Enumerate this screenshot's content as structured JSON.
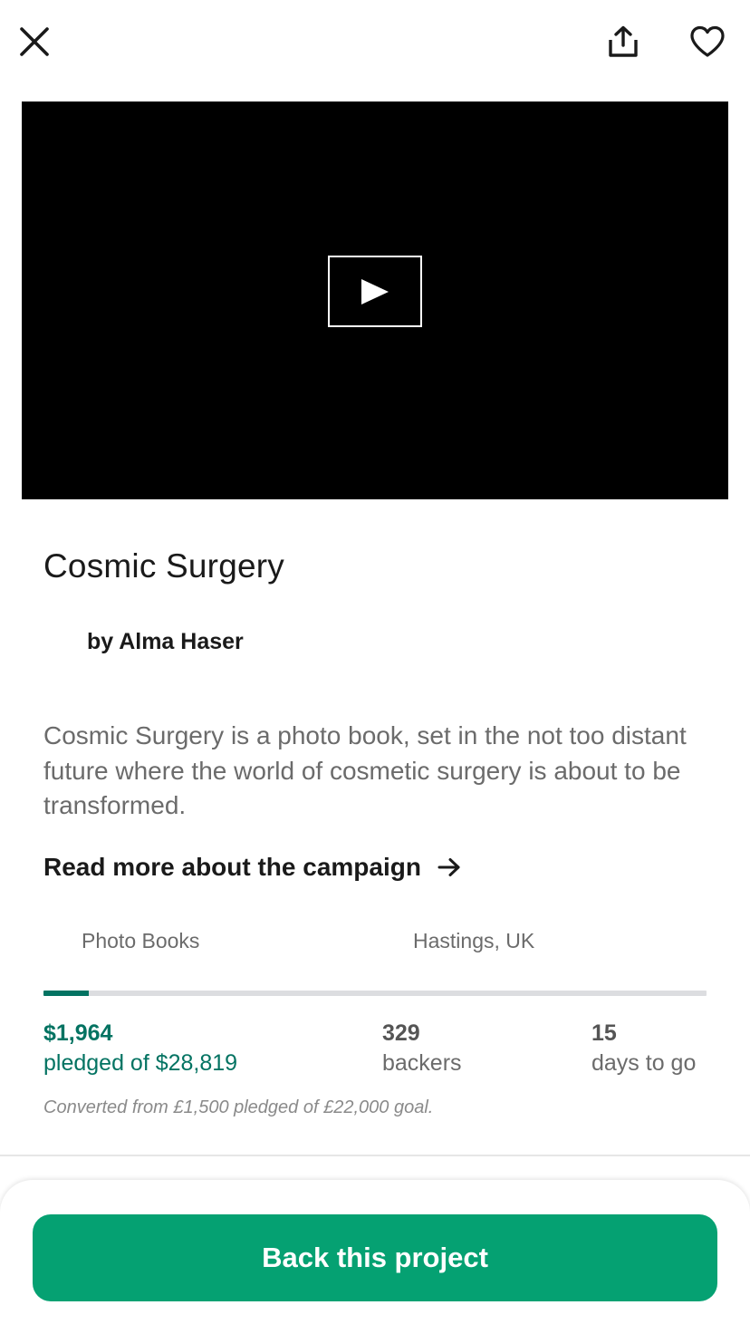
{
  "toolbar": {
    "close_icon": "close-icon",
    "share_icon": "share-icon",
    "favorite_icon": "heart-icon"
  },
  "video": {
    "play_icon": "play-icon"
  },
  "project": {
    "title": "Cosmic Surgery",
    "creator": "by Alma Haser",
    "blurb": "Cosmic Surgery is a photo book, set in the not too distant future where the world of cosmetic surgery is about to be transformed.",
    "read_more": "Read more about the campaign",
    "category": "Photo Books",
    "location": "Hastings, UK"
  },
  "funding": {
    "progress_fraction": 0.068,
    "pledged_amount": "$1,964",
    "pledged_label": "pledged of $28,819",
    "backers_count": "329",
    "backers_label": "backers",
    "days_count": "15",
    "days_label": "days to go",
    "conversion_note": "Converted from £1,500 pledged of £22,000 goal."
  },
  "cta": {
    "back_label": "Back this project"
  },
  "colors": {
    "accent_green": "#05a172",
    "pledge_green": "#037362",
    "progress_track": "#dcdde0"
  }
}
